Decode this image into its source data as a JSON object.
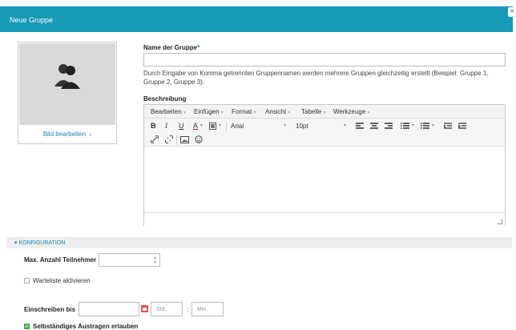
{
  "dialog": {
    "title": "Neue Gruppe",
    "close_glyph": "×"
  },
  "avatar": {
    "edit_label": "Bild bearbeiten",
    "edit_caret": "▾",
    "icon": "user-group-icon"
  },
  "group_name": {
    "label": "Name der Gruppe",
    "required_mark": "*",
    "value": "",
    "hint": "Durch Eingabe von Komma getrennten Gruppennamen werden mehrere Gruppen gleichzeitig erstellt (Beispiel: Gruppe 1, Gruppe 2, Gruppe 3)."
  },
  "description": {
    "label": "Beschreibung",
    "menus": [
      "Bearbeiten",
      "Einfügen",
      "Format",
      "Ansicht",
      "Tabelle",
      "Werkzeuge"
    ],
    "toolbar": {
      "bold": "B",
      "italic": "I",
      "underline": "U",
      "font_color": "A",
      "font": "Arial",
      "size": "10pt"
    }
  },
  "config": {
    "section_label": "KONFIGURATION",
    "max_participants_label": "Max. Anzahl Teilnehmer",
    "max_participants_value": "",
    "waitlist_label": "Warteliste aktivieren",
    "enroll_until_label": "Einschreiben bis",
    "hours_placeholder": "Std.",
    "time_separator": ":",
    "minutes_placeholder": "Min.",
    "self_unenroll_label": "Selbständiges Austragen erlauben"
  },
  "colors": {
    "header": "#1799b8",
    "link": "#1a86b6",
    "check": "#5cb85c"
  }
}
